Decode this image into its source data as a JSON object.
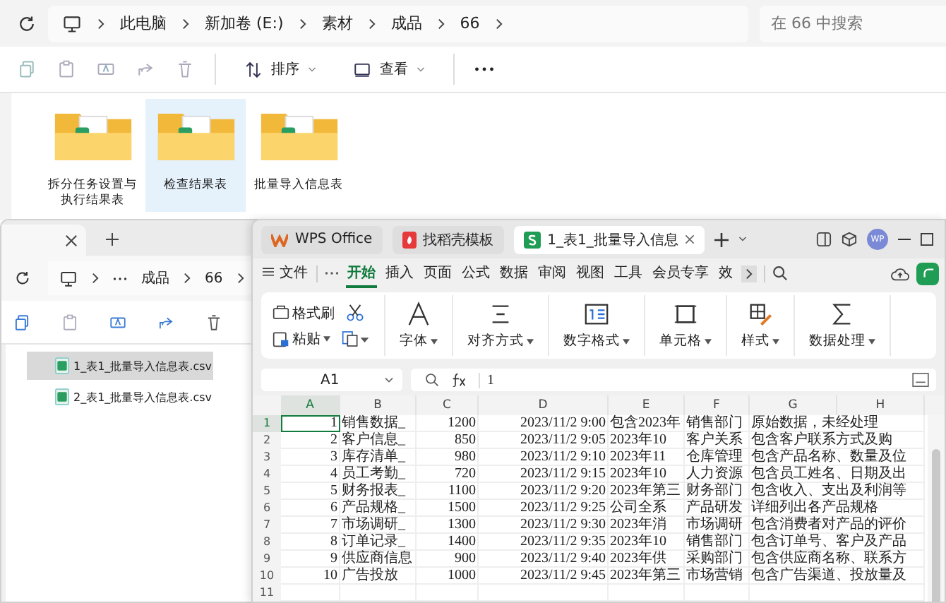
{
  "explorer_back": {
    "breadcrumb": [
      "此电脑",
      "新加卷 (E:)",
      "素材",
      "成品",
      "66"
    ],
    "search": {
      "placeholder": "在 66 中搜索"
    },
    "toolbar": [
      {
        "label": "排序",
        "kind": "sort"
      },
      {
        "label": "查看",
        "kind": "view"
      }
    ],
    "folders": [
      {
        "name": "拆分任务设置与执行结果表",
        "selected": false
      },
      {
        "name": "检查结果表",
        "selected": true
      },
      {
        "name": "批量导入信息表",
        "selected": false
      }
    ]
  },
  "explorer_front": {
    "breadcrumb": [
      "成品",
      "66"
    ],
    "files": [
      {
        "name": "1_表1_批量导入信息表.csv",
        "selected": true
      },
      {
        "name": "2_表1_批量导入信息表.csv",
        "selected": false
      }
    ]
  },
  "wps": {
    "tabs": [
      {
        "label": "WPS Office",
        "kind": "home",
        "selected": false
      },
      {
        "label": "找稻壳模板",
        "kind": "template",
        "selected": false
      },
      {
        "label": "1_表1_批量导入信息",
        "kind": "sheet",
        "selected": true
      }
    ],
    "avatar": "WP",
    "file_menu": "文件",
    "menu": [
      {
        "label": "开始",
        "selected": true
      },
      {
        "label": "插入",
        "selected": false
      },
      {
        "label": "页面",
        "selected": false
      },
      {
        "label": "公式",
        "selected": false
      },
      {
        "label": "数据",
        "selected": false
      },
      {
        "label": "审阅",
        "selected": false
      },
      {
        "label": "视图",
        "selected": false
      },
      {
        "label": "工具",
        "selected": false
      },
      {
        "label": "会员专享",
        "selected": false
      },
      {
        "label": "效",
        "selected": false
      }
    ],
    "clipboard": {
      "format_painter": "格式刷",
      "paste": "粘贴"
    },
    "ribbon": [
      {
        "label": "字体",
        "kind": "font"
      },
      {
        "label": "对齐方式",
        "kind": "align"
      },
      {
        "label": "数字格式",
        "kind": "number"
      },
      {
        "label": "单元格",
        "kind": "cell"
      },
      {
        "label": "样式",
        "kind": "style"
      },
      {
        "label": "数据处理",
        "kind": "data"
      }
    ],
    "name_box": "A1",
    "formula": "1",
    "columns": [
      "A",
      "B",
      "C",
      "D",
      "E",
      "F",
      "G",
      "H"
    ],
    "rows": [
      {
        "num": "1",
        "cells": [
          "1",
          "销售数据_",
          "1200",
          "2023/11/2  9:00",
          "包含2023年",
          "销售部门",
          "原始数据，未经处理"
        ]
      },
      {
        "num": "2",
        "cells": [
          "2",
          "客户信息_",
          "850",
          "2023/11/2  9:05",
          "2023年10",
          "客户关系",
          "包含客户联系方式及购"
        ]
      },
      {
        "num": "3",
        "cells": [
          "3",
          "库存清单_",
          "980",
          "2023/11/2  9:10",
          "2023年11",
          "仓库管理",
          "包含产品名称、数量及位"
        ]
      },
      {
        "num": "4",
        "cells": [
          "4",
          "员工考勤_",
          "720",
          "2023/11/2  9:15",
          "2023年10",
          "人力资源",
          "包含员工姓名、日期及出"
        ]
      },
      {
        "num": "5",
        "cells": [
          "5",
          "财务报表_",
          "1100",
          "2023/11/2  9:20",
          "2023年第三",
          "财务部门",
          "包含收入、支出及利润等"
        ]
      },
      {
        "num": "6",
        "cells": [
          "6",
          "产品规格_",
          "1500",
          "2023/11/2  9:25",
          "公司全系",
          "产品研发",
          "详细列出各产品规格"
        ]
      },
      {
        "num": "7",
        "cells": [
          "7",
          "市场调研_",
          "1300",
          "2023/11/2  9:30",
          "2023年消",
          "市场调研",
          "包含消费者对产品的评价"
        ]
      },
      {
        "num": "8",
        "cells": [
          "8",
          "订单记录_",
          "1400",
          "2023/11/2  9:35",
          "2023年10",
          "销售部门",
          "包含订单号、客户及产品"
        ]
      },
      {
        "num": "9",
        "cells": [
          "9",
          "供应商信息",
          "900",
          "2023/11/2  9:40",
          "2023年供",
          "采购部门",
          "包含供应商名称、联系方"
        ]
      },
      {
        "num": "10",
        "cells": [
          "10",
          "广告投放",
          "1000",
          "2023/11/2  9:45",
          "2023年第三",
          "市场营销",
          "包含广告渠道、投放量及"
        ]
      },
      {
        "num": "11"
      }
    ]
  }
}
